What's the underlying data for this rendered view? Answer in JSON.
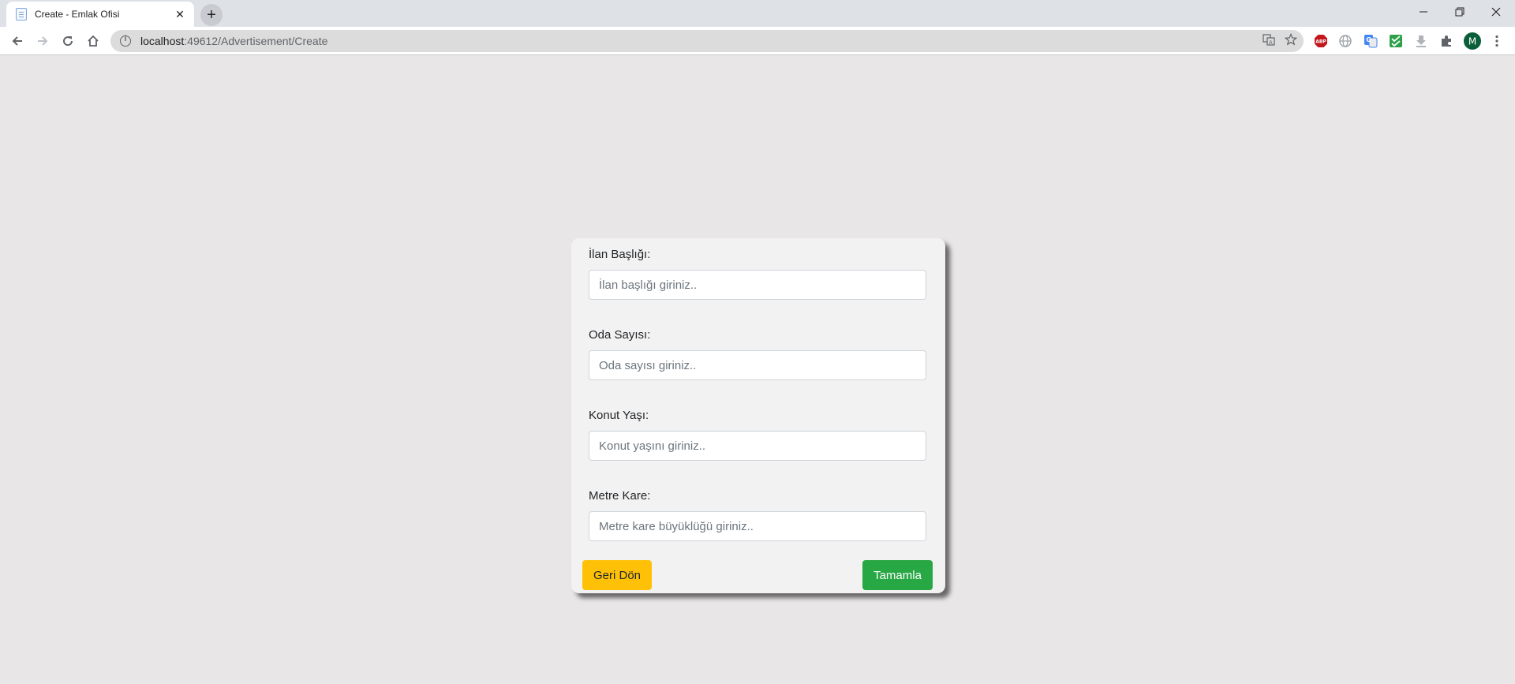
{
  "browser": {
    "tab": {
      "title": "Create - Emlak Ofisi"
    },
    "address": {
      "host": "localhost",
      "path": ":49612/Advertisement/Create"
    },
    "profile_initial": "M",
    "colors": {
      "profile_bg": "#0b5e3a",
      "abp_red": "#c4161c"
    }
  },
  "form": {
    "fields": [
      {
        "label": "İlan Başlığı:",
        "placeholder": "İlan başlığı giriniz.."
      },
      {
        "label": "Oda Sayısı:",
        "placeholder": "Oda sayısı giriniz.."
      },
      {
        "label": "Konut Yaşı:",
        "placeholder": "Konut yaşını giriniz.."
      },
      {
        "label": "Metre Kare:",
        "placeholder": "Metre kare büyüklüğü giriniz.."
      }
    ],
    "back_label": "Geri Dön",
    "submit_label": "Tamamla",
    "colors": {
      "back": "#ffc107",
      "submit": "#28a745"
    }
  }
}
